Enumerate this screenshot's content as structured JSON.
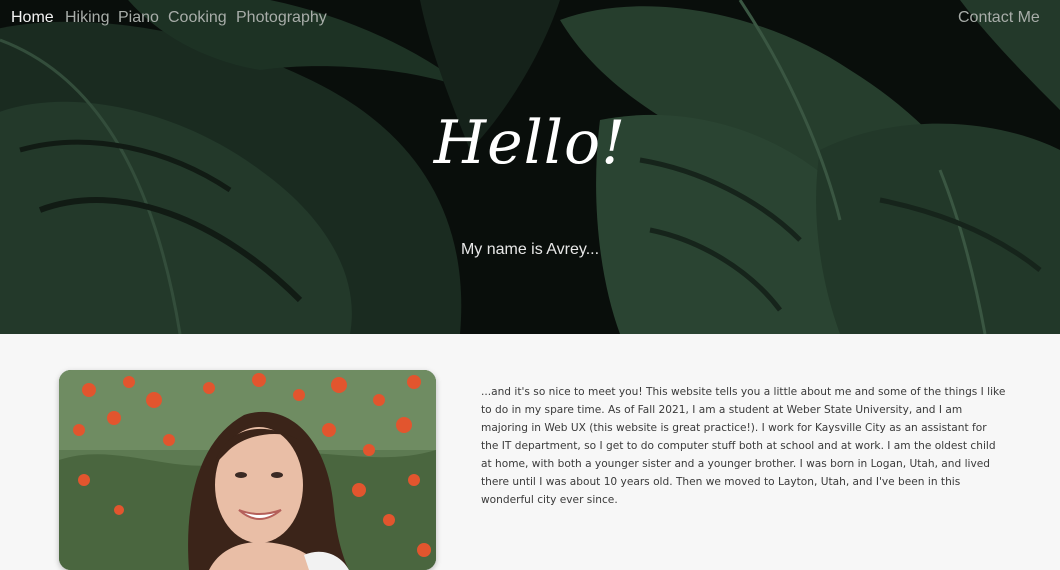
{
  "nav": {
    "items": [
      {
        "label": "Home"
      },
      {
        "label": "Hiking"
      },
      {
        "label": "Piano"
      },
      {
        "label": "Cooking"
      },
      {
        "label": "Photography"
      }
    ],
    "contact": "Contact Me"
  },
  "hero": {
    "title": "Hello!",
    "subtitle": "My name is Avrey..."
  },
  "about": {
    "text": "...and it's so nice to meet you! This website tells you a little about me and some of the things I like to do in my spare time. As of Fall 2021, I am a student at Weber State University, and I am majoring in Web UX (this website is great practice!). I work for Kaysville City as an assistant for the IT department, so I get to do computer stuff both at school and at work. I am the oldest child at home, with both a younger sister and a younger brother. I was born in Logan, Utah, and lived there until I was about 10 years old. Then we moved to Layton, Utah, and I've been in this wonderful city ever since."
  },
  "colors": {
    "hero_bg": "#0e1410",
    "leaf": "#2c4a36",
    "page_bg": "#f7f7f7",
    "nav_active": "#f2f2f2",
    "nav_inactive": "#a8ada9"
  }
}
